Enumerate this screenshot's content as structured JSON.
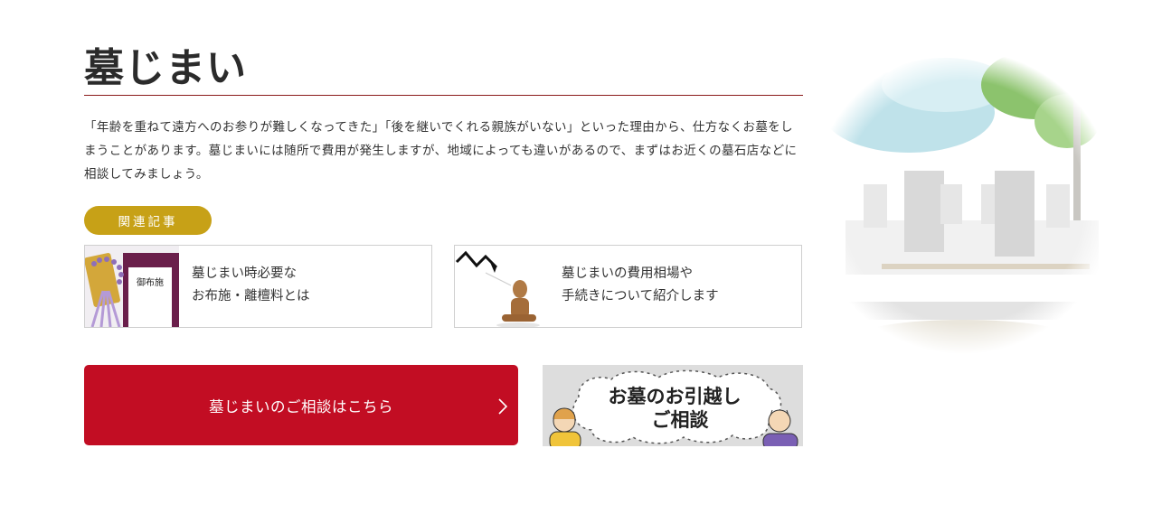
{
  "section": {
    "title": "墓じまい",
    "description": "「年齢を重ねて遠方へのお参りが難しくなってきた」「後を継いでくれる親族がいない」といった理由から、仕方なくお墓をしまうことがあります。墓じまいには随所で費用が発生しますが、地域によっても違いがあるので、まずはお近くの墓石店などに相談してみましょう。"
  },
  "related": {
    "tag_label": "関連記事",
    "cards": [
      {
        "line1": "墓じまい時必要な",
        "line2": "お布施・離檀料とは",
        "thumb_icon": "prayer-beads-envelope-icon",
        "envelope_text": "御布施"
      },
      {
        "line1": "墓じまいの費用相場や",
        "line2": "手続きについて紹介します",
        "thumb_icon": "wooden-mannequin-graph-icon"
      }
    ]
  },
  "consult_button": {
    "label": "墓じまいのご相談はこちら"
  },
  "banner": {
    "line1": "お墓のお引越し",
    "line2": "ご相談"
  },
  "colors": {
    "accent_red": "#c20d23",
    "tag_gold": "#c7a117",
    "rule_red": "#8b1a1a"
  }
}
